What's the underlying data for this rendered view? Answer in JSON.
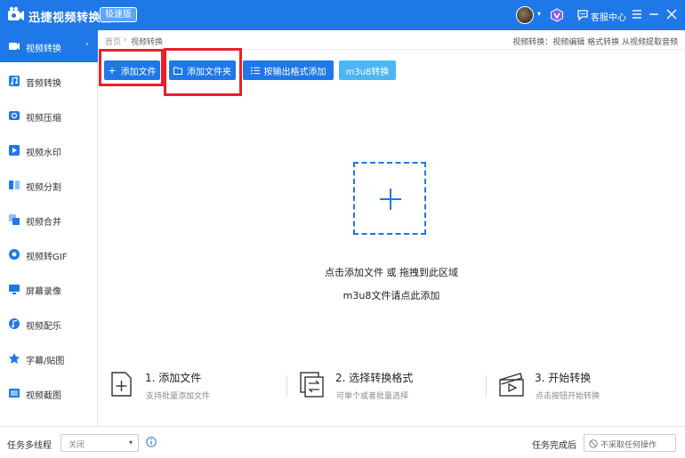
{
  "app": {
    "title": "迅捷视频转换器",
    "badge": "极速版",
    "service_label": "客服中心",
    "avatar_caret": "▾"
  },
  "colors": {
    "primary": "#1f78e8",
    "m3u8": "#4cb6f5",
    "highlight": "#e8202b"
  },
  "sidebar": {
    "items": [
      {
        "label": "视频转换",
        "icon": "video-convert-icon",
        "active": true
      },
      {
        "label": "音频转换",
        "icon": "audio-convert-icon"
      },
      {
        "label": "视频压缩",
        "icon": "video-compress-icon"
      },
      {
        "label": "视频水印",
        "icon": "video-watermark-icon"
      },
      {
        "label": "视频分割",
        "icon": "video-split-icon"
      },
      {
        "label": "视频合并",
        "icon": "video-merge-icon"
      },
      {
        "label": "视频转GIF",
        "icon": "gif-icon"
      },
      {
        "label": "屏幕录像",
        "icon": "screen-record-icon"
      },
      {
        "label": "视频配乐",
        "icon": "music-icon"
      },
      {
        "label": "字幕/贴图",
        "icon": "subtitle-icon"
      },
      {
        "label": "视频截图",
        "icon": "screenshot-icon"
      }
    ],
    "active_arrow": "›"
  },
  "breadcrumb": {
    "home": "首页",
    "separator": "›",
    "current": "视频转换",
    "right_text": "视频转换：视频编辑 格式转换 从视频提取音频"
  },
  "toolbar": {
    "add_file": "添加文件",
    "add_folder": "添加文件夹",
    "by_format": "按输出格式添加",
    "m3u8": "m3u8转换"
  },
  "dropzone": {
    "hint": "点击添加文件 或 拖拽到此区域",
    "m3u8_hint": "m3u8文件请点此添加"
  },
  "steps": [
    {
      "title": "1. 添加文件",
      "sub": "支持批量添加文件"
    },
    {
      "title": "2. 选择转换格式",
      "sub": "可单个或者批量选择"
    },
    {
      "title": "3. 开始转换",
      "sub": "点击按钮开始转换"
    }
  ],
  "bottom": {
    "multi_thread_label": "任务多线程",
    "multi_thread_value": "关闭",
    "after_done_label": "任务完成后",
    "after_done_value": "不采取任何操作"
  }
}
